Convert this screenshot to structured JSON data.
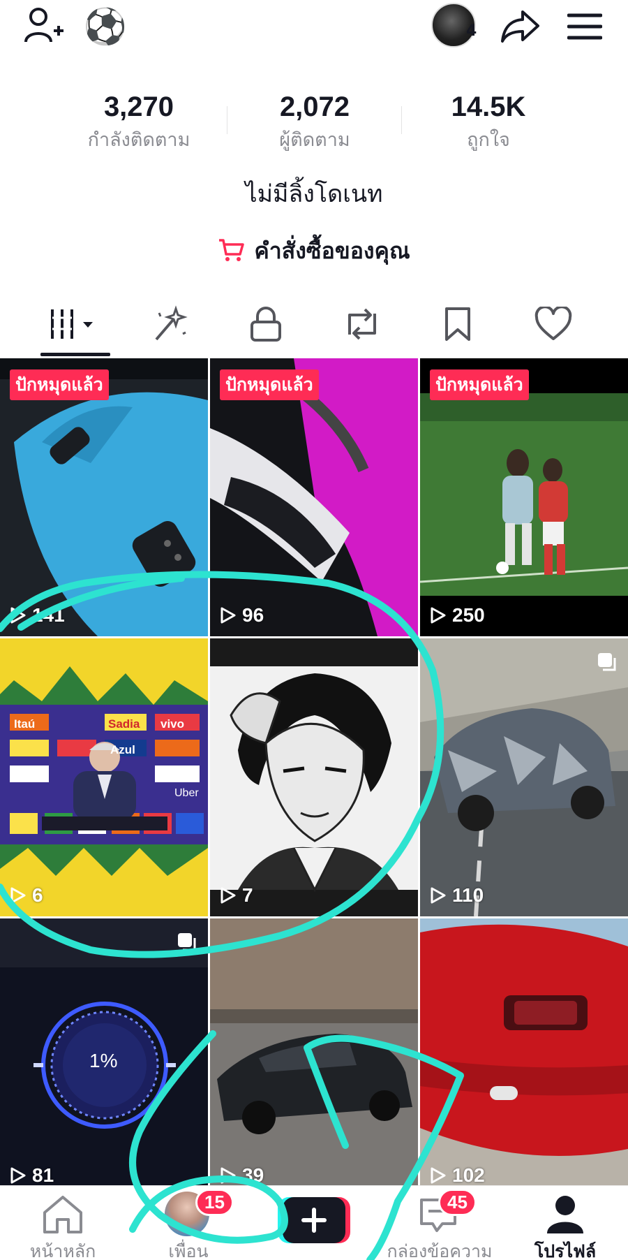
{
  "topbar": {
    "add_friend_icon": "add-user-icon",
    "emoji": "⚽",
    "avatar_count": "4",
    "share_icon": "share-arrow-icon",
    "menu_icon": "hamburger-menu-icon"
  },
  "stats": [
    {
      "value": "3,270",
      "label": "กำลังติดตาม"
    },
    {
      "value": "2,072",
      "label": "ผู้ติดตาม"
    },
    {
      "value": "14.5K",
      "label": "ถูกใจ"
    }
  ],
  "bio": "ไม่มีลิ้งโดเนท",
  "orders": {
    "label": "คำสั่งซื้อของคุณ",
    "icon": "shopping-cart-icon",
    "icon_color": "#fe2c55"
  },
  "tabs": [
    {
      "icon": "grid-videos-icon",
      "active": true
    },
    {
      "icon": "magic-wand-icon"
    },
    {
      "icon": "lock-icon"
    },
    {
      "icon": "repost-icon"
    },
    {
      "icon": "bookmark-icon"
    },
    {
      "icon": "heart-icon"
    }
  ],
  "videos": [
    {
      "pinned_label": "ปักหมุดแล้ว",
      "views": "141"
    },
    {
      "pinned_label": "ปักหมุดแล้ว",
      "views": "96"
    },
    {
      "pinned_label": "ปักหมุดแล้ว",
      "views": "250"
    },
    {
      "views": "6"
    },
    {
      "views": "7"
    },
    {
      "views": "110"
    },
    {
      "views": "81"
    },
    {
      "views": "39"
    },
    {
      "views": "102"
    }
  ],
  "thumb_texts": {
    "brand_1": "Itaú",
    "brand_2": "Sadia",
    "brand_3": "vivo",
    "brand_4": "Azul",
    "brand_5": "Uber",
    "battery_percent": "1%"
  },
  "bottom_nav": [
    {
      "label": "หน้าหลัก",
      "icon": "home-icon"
    },
    {
      "label": "เพื่อน",
      "icon": "friends-avatar",
      "badge": "15"
    },
    {
      "label": "",
      "icon": "plus-icon"
    },
    {
      "label": "กล่องข้อความ",
      "icon": "inbox-icon",
      "badge": "45"
    },
    {
      "label": "โปรไฟล์",
      "icon": "profile-icon",
      "active": true
    }
  ],
  "colors": {
    "accent": "#fe2c55",
    "scribble": "#2de3d0",
    "text": "#161823",
    "muted": "#8a8b91"
  }
}
